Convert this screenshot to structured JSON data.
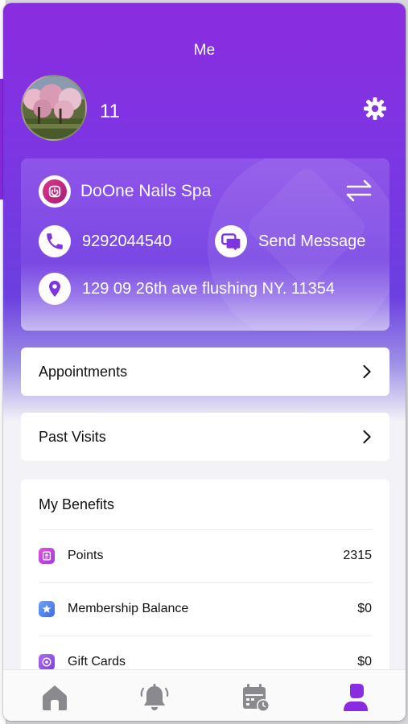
{
  "header": {
    "title": "Me"
  },
  "profile": {
    "name": "11"
  },
  "store": {
    "name": "DoOne Nails Spa",
    "phone": "9292044540",
    "message_label": "Send Message",
    "address": "129 09 26th ave flushing  NY. 11354"
  },
  "menu": {
    "appointments_label": "Appointments",
    "past_visits_label": "Past Visits"
  },
  "benefits": {
    "title": "My Benefits",
    "items": [
      {
        "label": "Points",
        "value": "2315",
        "icon": "points-icon",
        "color": "#c44ce0"
      },
      {
        "label": "Membership Balance",
        "value": "$0",
        "icon": "star-badge-icon",
        "color": "#4a7df0"
      },
      {
        "label": "Gift Cards",
        "value": "$0",
        "icon": "gift-card-icon",
        "color": "#9b4de0"
      }
    ]
  },
  "tabs": [
    {
      "name": "home",
      "icon": "home-icon",
      "active": false
    },
    {
      "name": "notifications",
      "icon": "bell-icon",
      "active": false
    },
    {
      "name": "schedule",
      "icon": "calendar-clock-icon",
      "active": false
    },
    {
      "name": "me",
      "icon": "person-icon",
      "active": true
    }
  ],
  "colors": {
    "accent": "#8a2be2",
    "tab_inactive": "#8a8a8e",
    "tab_active": "#8a2be2"
  }
}
